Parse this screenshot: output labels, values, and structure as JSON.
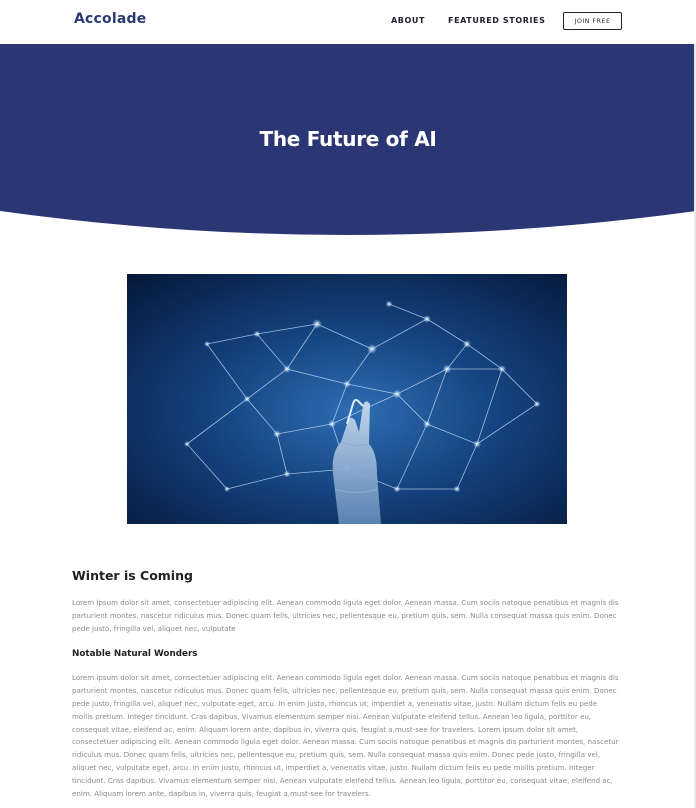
{
  "brand": {
    "logo_text": "Accolade",
    "primary_color": "#2b3674"
  },
  "nav": {
    "about_label": "ABOUT",
    "featured_label": "FEATURED STORIES",
    "join_label": "JOIN FREE"
  },
  "hero": {
    "title": "The Future of AI",
    "background_color": "#2b3674"
  },
  "feature_image": {
    "description_icon": "ai-network-robot-hand-image"
  },
  "article": {
    "heading": "Winter is Coming",
    "paragraph1": "Lorem ipsum dolor sit amet, consectetuer adipiscing elit. Aenean commodo ligula eget dolor. Aenean massa. Cum sociis natoque penatibus et magnis dis parturient montes, nascetur ridiculus mus. Donec quam felis, ultricies nec, pellentesque eu, pretium quis, sem. Nulla consequat massa quis enim. Donec pede justo, fringilla vel, aliquet nec, vulputate",
    "subheading": "Notable Natural Wonders",
    "paragraph2": "Lorem ipsum dolor sit amet, consectetuer adipiscing elit. Aenean commodo ligula eget dolor. Aenean massa. Cum sociis natoque penatibus et magnis dis parturient montes, nascetur ridiculus mus. Donec quam felis, ultricies nec, pellentesque eu, pretium quis, sem. Nulla consequat massa quis enim. Donec pede justo, fringilla vel, aliquet nec, vulputate eget, arcu. In enim justo, rhoncus ut, imperdiet a, venenatis vitae, justo. Nullam dictum felis eu pede mollis pretium. Integer tincidunt. Cras dapibus. Vivamus elementum semper nisi. Aenean vulputate eleifend tellus. Aenean leo ligula, porttitor eu, consequat vitae, eleifend ac, enim. Aliquam lorem ante, dapibus in, viverra quis, feugiat a,must-see for travelers. Lorem ipsum dolor sit amet, consectetuer adipiscing elit. Aenean commodo ligula eget dolor. Aenean massa. Cum sociis natoque penatibus et magnis dis parturient montes, nascetur ridiculus mus. Donec quam felis, ultricies nec, pellentesque eu, pretium quis, sem. Nulla consequat massa quis enim. Donec pede justo, fringilla vel, aliquet nec, vulputate eget, arcu. In enim justo, rhoncus ut, imperdiet a, venenatis vitae, justo. Nullam dictum felis eu pede mollis pretium. Integer tincidunt. Cras dapibus. Vivamus elementum semper nisi. Aenean vulputate eleifend tellus. Aenean leo ligula, porttitor eu, consequat vitae, eleifend ac, enim. Aliquam lorem ante, dapibus in, viverra quis, feugiat a,must-see for travelers."
  }
}
